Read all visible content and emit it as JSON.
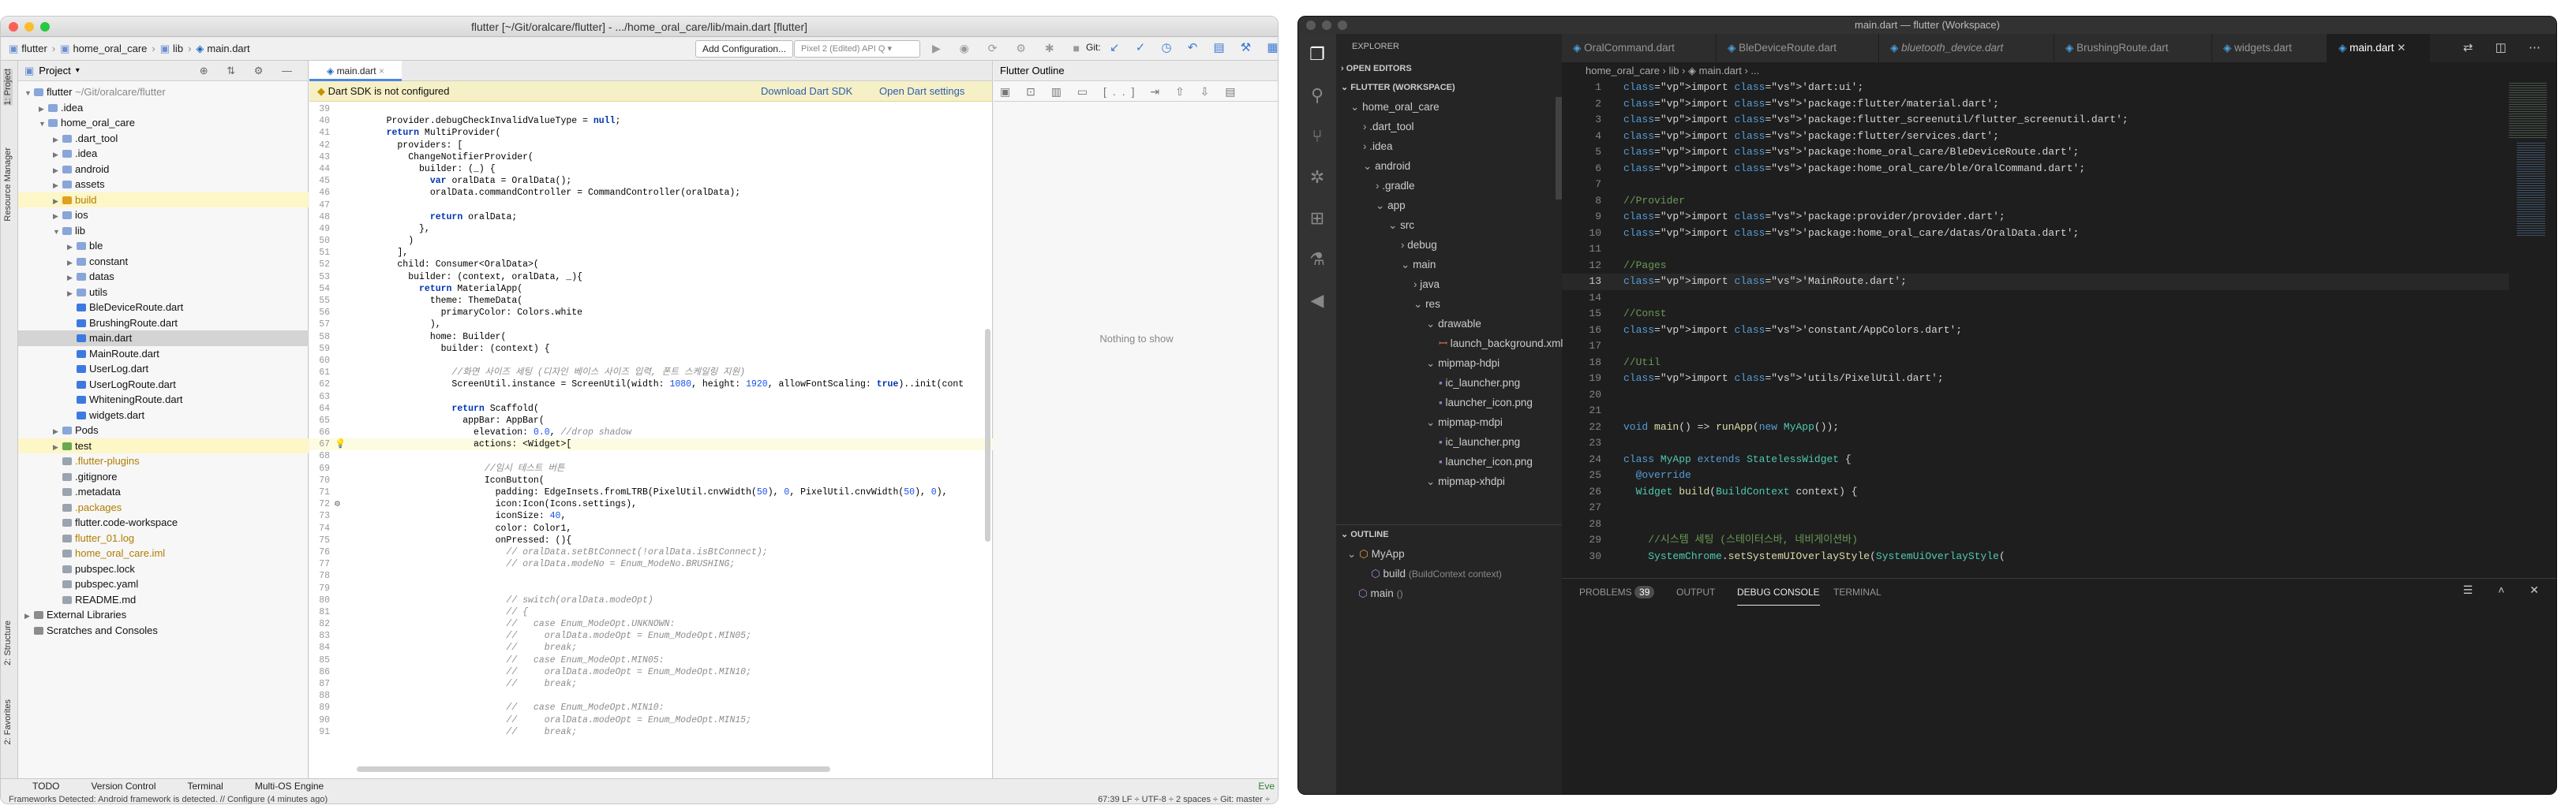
{
  "android_studio": {
    "title": "flutter [~/Git/oralcare/flutter] - .../home_oral_care/lib/main.dart [flutter]",
    "nav": [
      "flutter",
      "home_oral_care",
      "lib",
      "main.dart"
    ],
    "add_config": "Add Configuration...",
    "device": "Pixel 2 (Edited) API Q",
    "git_label": "Git:",
    "project_label": "Project",
    "left_strip": [
      "1: Project",
      "Resource Manager",
      "2: Structure",
      "2: Favorites"
    ],
    "tree": [
      {
        "d": 0,
        "c": "v",
        "t": "flutter",
        "x": " ~/Git/oralcare/flutter",
        "k": "folder"
      },
      {
        "d": 1,
        "c": ">",
        "t": ".idea",
        "k": "folder"
      },
      {
        "d": 1,
        "c": "v",
        "t": "home_oral_care",
        "k": "folder"
      },
      {
        "d": 2,
        "c": ">",
        "t": ".dart_tool",
        "k": "folder"
      },
      {
        "d": 2,
        "c": ">",
        "t": ".idea",
        "k": "folder"
      },
      {
        "d": 2,
        "c": ">",
        "t": "android",
        "k": "folder"
      },
      {
        "d": 2,
        "c": ">",
        "t": "assets",
        "k": "folder"
      },
      {
        "d": 2,
        "c": ">",
        "t": "build",
        "k": "ofolder",
        "hl": true
      },
      {
        "d": 2,
        "c": ">",
        "t": "ios",
        "k": "folder"
      },
      {
        "d": 2,
        "c": "v",
        "t": "lib",
        "k": "folder"
      },
      {
        "d": 3,
        "c": ">",
        "t": "ble",
        "k": "folder"
      },
      {
        "d": 3,
        "c": ">",
        "t": "constant",
        "k": "folder"
      },
      {
        "d": 3,
        "c": ">",
        "t": "datas",
        "k": "folder"
      },
      {
        "d": 3,
        "c": ">",
        "t": "utils",
        "k": "folder"
      },
      {
        "d": 3,
        "c": "",
        "t": "BleDeviceRoute.dart",
        "k": "dart"
      },
      {
        "d": 3,
        "c": "",
        "t": "BrushingRoute.dart",
        "k": "dart"
      },
      {
        "d": 3,
        "c": "",
        "t": "main.dart",
        "k": "dart",
        "sel": true
      },
      {
        "d": 3,
        "c": "",
        "t": "MainRoute.dart",
        "k": "dart"
      },
      {
        "d": 3,
        "c": "",
        "t": "UserLog.dart",
        "k": "dart"
      },
      {
        "d": 3,
        "c": "",
        "t": "UserLogRoute.dart",
        "k": "dart"
      },
      {
        "d": 3,
        "c": "",
        "t": "WhiteningRoute.dart",
        "k": "dart"
      },
      {
        "d": 3,
        "c": "",
        "t": "widgets.dart",
        "k": "dart"
      },
      {
        "d": 2,
        "c": ">",
        "t": "Pods",
        "k": "folder"
      },
      {
        "d": 2,
        "c": ">",
        "t": "test",
        "k": "gfolder",
        "hl": true
      },
      {
        "d": 2,
        "c": "",
        "t": ".flutter-plugins",
        "k": "file",
        "col": "#b07d00"
      },
      {
        "d": 2,
        "c": "",
        "t": ".gitignore",
        "k": "file"
      },
      {
        "d": 2,
        "c": "",
        "t": ".metadata",
        "k": "file"
      },
      {
        "d": 2,
        "c": "",
        "t": ".packages",
        "k": "file",
        "col": "#b07d00"
      },
      {
        "d": 2,
        "c": "",
        "t": "flutter.code-workspace",
        "k": "file"
      },
      {
        "d": 2,
        "c": "",
        "t": "flutter_01.log",
        "k": "file",
        "col": "#b07d00"
      },
      {
        "d": 2,
        "c": "",
        "t": "home_oral_care.iml",
        "k": "file",
        "col": "#b07d00"
      },
      {
        "d": 2,
        "c": "",
        "t": "pubspec.lock",
        "k": "file"
      },
      {
        "d": 2,
        "c": "",
        "t": "pubspec.yaml",
        "k": "file"
      },
      {
        "d": 2,
        "c": "",
        "t": "README.md",
        "k": "file"
      },
      {
        "d": 0,
        "c": ">",
        "t": "External Libraries",
        "k": "lib"
      },
      {
        "d": 0,
        "c": "",
        "t": "Scratches and Consoles",
        "k": "lib"
      }
    ],
    "editor_tab": "main.dart",
    "banner": {
      "msg": "Dart SDK is not configured",
      "link1": "Download Dart SDK",
      "link2": "Open Dart settings"
    },
    "code": [
      [
        "39",
        ""
      ],
      [
        "40",
        "    Provider.debugCheckInvalidValueType = null;"
      ],
      [
        "41",
        "    return MultiProvider("
      ],
      [
        "42",
        "      providers: ["
      ],
      [
        "43",
        "        ChangeNotifierProvider("
      ],
      [
        "44",
        "          builder: (_) {"
      ],
      [
        "45",
        "            var oralData = OralData();"
      ],
      [
        "46",
        "            oralData.commandController = CommandController(oralData);"
      ],
      [
        "47",
        ""
      ],
      [
        "48",
        "            return oralData;"
      ],
      [
        "49",
        "          },"
      ],
      [
        "50",
        "        )"
      ],
      [
        "51",
        "      ],"
      ],
      [
        "52",
        "      child: Consumer<OralData>("
      ],
      [
        "53",
        "        builder: (context, oralData, _){"
      ],
      [
        "54",
        "          return MaterialApp("
      ],
      [
        "55",
        "            theme: ThemeData("
      ],
      [
        "56",
        "              primaryColor: Colors.white"
      ],
      [
        "57",
        "            ),"
      ],
      [
        "58",
        "            home: Builder("
      ],
      [
        "59",
        "              builder: (context) {"
      ],
      [
        "60",
        ""
      ],
      [
        "61",
        "                //화면 사이즈 세팅 (디자인 베이스 사이즈 입력, 폰트 스케일링 지원)"
      ],
      [
        "62",
        "                ScreenUtil.instance = ScreenUtil(width: 1080, height: 1920, allowFontScaling: true)..init(cont"
      ],
      [
        "63",
        ""
      ],
      [
        "64",
        "                return Scaffold("
      ],
      [
        "65",
        "                  appBar: AppBar("
      ],
      [
        "66",
        "                    elevation: 0.0, //drop shadow"
      ],
      [
        "67",
        "                    actions: <Widget>["
      ],
      [
        "68",
        ""
      ],
      [
        "69",
        "                      //임시 테스트 버튼"
      ],
      [
        "70",
        "                      IconButton("
      ],
      [
        "71",
        "                        padding: EdgeInsets.fromLTRB(PixelUtil.cnvWidth(50), 0, PixelUtil.cnvWidth(50), 0),"
      ],
      [
        "72",
        "                        icon:Icon(Icons.settings),"
      ],
      [
        "73",
        "                        iconSize: 40,"
      ],
      [
        "74",
        "                        color: Color1,"
      ],
      [
        "75",
        "                        onPressed: (){"
      ],
      [
        "76",
        "                          // oralData.setBtConnect(!oralData.isBtConnect);"
      ],
      [
        "77",
        "                          // oralData.modeNo = Enum_ModeNo.BRUSHING;"
      ],
      [
        "78",
        ""
      ],
      [
        "79",
        ""
      ],
      [
        "80",
        "                          // switch(oralData.modeOpt)"
      ],
      [
        "81",
        "                          // {"
      ],
      [
        "82",
        "                          //   case Enum_ModeOpt.UNKNOWN:"
      ],
      [
        "83",
        "                          //     oralData.modeOpt = Enum_ModeOpt.MIN05;"
      ],
      [
        "84",
        "                          //     break;"
      ],
      [
        "85",
        "                          //   case Enum_ModeOpt.MIN05:"
      ],
      [
        "86",
        "                          //     oralData.modeOpt = Enum_ModeOpt.MIN10;"
      ],
      [
        "87",
        "                          //     break;"
      ],
      [
        "88",
        ""
      ],
      [
        "89",
        "                          //   case Enum_ModeOpt.MIN10:"
      ],
      [
        "90",
        "                          //     oralData.modeOpt = Enum_ModeOpt.MIN15;"
      ],
      [
        "91",
        "                          //     break;"
      ]
    ],
    "outline_title": "Flutter Outline",
    "outline_empty": "Nothing to show",
    "bottom_tabs": [
      "TODO",
      "Version Control",
      "Terminal",
      "Multi-OS Engine"
    ],
    "event": "Eve",
    "status_msg": "Frameworks Detected: Android framework is detected. // Configure (4 minutes ago)",
    "status_right": "67:39  LF ÷  UTF-8 ÷  2 spaces ÷  Git: master ÷"
  },
  "vscode": {
    "title": "main.dart — flutter (Workspace)",
    "explorer": "EXPLORER",
    "open_editors": "OPEN EDITORS",
    "workspace": "FLUTTER (WORKSPACE)",
    "tree": [
      {
        "d": 0,
        "c": "v",
        "t": "home_oral_care"
      },
      {
        "d": 1,
        "c": ">",
        "t": ".dart_tool"
      },
      {
        "d": 1,
        "c": ">",
        "t": ".idea"
      },
      {
        "d": 1,
        "c": "v",
        "t": "android"
      },
      {
        "d": 2,
        "c": ">",
        "t": ".gradle"
      },
      {
        "d": 2,
        "c": "v",
        "t": "app"
      },
      {
        "d": 3,
        "c": "v",
        "t": "src"
      },
      {
        "d": 4,
        "c": ">",
        "t": "debug"
      },
      {
        "d": 4,
        "c": "v",
        "t": "main"
      },
      {
        "d": 5,
        "c": ">",
        "t": "java"
      },
      {
        "d": 5,
        "c": "v",
        "t": "res"
      },
      {
        "d": 6,
        "c": "v",
        "t": "drawable"
      },
      {
        "d": 7,
        "c": "x",
        "t": "launch_background.xml"
      },
      {
        "d": 6,
        "c": "v",
        "t": "mipmap-hdpi"
      },
      {
        "d": 7,
        "c": "i",
        "t": "ic_launcher.png"
      },
      {
        "d": 7,
        "c": "i",
        "t": "launcher_icon.png"
      },
      {
        "d": 6,
        "c": "v",
        "t": "mipmap-mdpi"
      },
      {
        "d": 7,
        "c": "i",
        "t": "ic_launcher.png"
      },
      {
        "d": 7,
        "c": "i",
        "t": "launcher_icon.png"
      },
      {
        "d": 6,
        "c": "v",
        "t": "mipmap-xhdpi"
      }
    ],
    "outline": "OUTLINE",
    "outline_items": [
      {
        "t": "MyApp",
        "s": ""
      },
      {
        "t": "build",
        "s": "(BuildContext context)"
      },
      {
        "t": "main",
        "s": "()"
      }
    ],
    "tabs": [
      "OralCommand.dart",
      "BleDeviceRoute.dart",
      "bluetooth_device.dart",
      "BrushingRoute.dart",
      "widgets.dart",
      "main.dart"
    ],
    "breadcrumb": "home_oral_care › lib › ◈ main.dart › ...",
    "code": [
      [
        "1",
        "import 'dart:ui';"
      ],
      [
        "2",
        "import 'package:flutter/material.dart';"
      ],
      [
        "3",
        "import 'package:flutter_screenutil/flutter_screenutil.dart';"
      ],
      [
        "4",
        "import 'package:flutter/services.dart';"
      ],
      [
        "5",
        "import 'package:home_oral_care/BleDeviceRoute.dart';"
      ],
      [
        "6",
        "import 'package:home_oral_care/ble/OralCommand.dart';"
      ],
      [
        "7",
        ""
      ],
      [
        "8",
        "//Provider"
      ],
      [
        "9",
        "import 'package:provider/provider.dart';"
      ],
      [
        "10",
        "import 'package:home_oral_care/datas/OralData.dart';"
      ],
      [
        "11",
        ""
      ],
      [
        "12",
        "//Pages"
      ],
      [
        "13",
        "import 'MainRoute.dart';"
      ],
      [
        "14",
        ""
      ],
      [
        "15",
        "//Const"
      ],
      [
        "16",
        "import 'constant/AppColors.dart';"
      ],
      [
        "17",
        ""
      ],
      [
        "18",
        "//Util"
      ],
      [
        "19",
        "import 'utils/PixelUtil.dart';"
      ],
      [
        "20",
        ""
      ],
      [
        "21",
        ""
      ],
      [
        "22",
        "void main() => runApp(new MyApp());"
      ],
      [
        "23",
        ""
      ],
      [
        "24",
        "class MyApp extends StatelessWidget {"
      ],
      [
        "25",
        "  @override"
      ],
      [
        "26",
        "  Widget build(BuildContext context) {"
      ],
      [
        "27",
        ""
      ],
      [
        "28",
        ""
      ],
      [
        "29",
        "    //시스템 세팅 (스테이터스바, 네비게이션바)"
      ],
      [
        "30",
        "    SystemChrome.setSystemUIOverlayStyle(SystemUiOverlayStyle("
      ]
    ],
    "panel_tabs": [
      "PROBLEMS",
      "OUTPUT",
      "DEBUG CONSOLE",
      "TERMINAL"
    ],
    "problems_count": "39"
  }
}
